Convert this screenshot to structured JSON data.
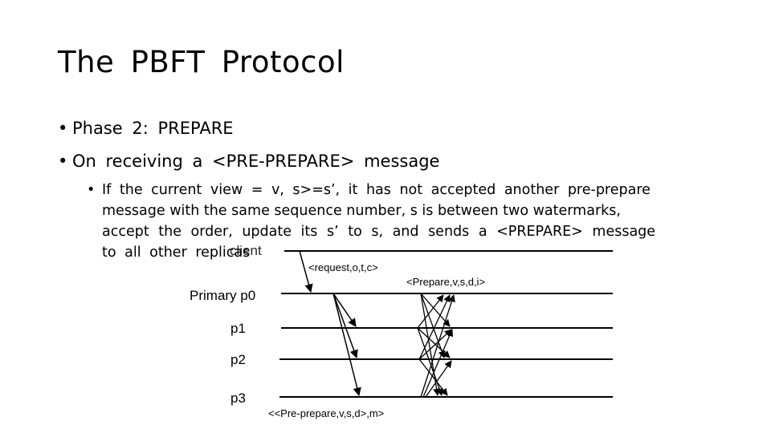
{
  "slide": {
    "title": "The  PBFT  Protocol",
    "bullets": [
      {
        "dot": "•",
        "text": "Phase  2:  PREPARE"
      },
      {
        "dot": "•",
        "text": "On  receiving  a  <PRE-PREPARE>  message"
      }
    ],
    "sub_bullet": {
      "dot": "•",
      "lines": [
        "If  the  current  view  =  v,  s>=s’,  it has not accepted another pre-prepare",
        "message with the same sequence number, s is between two watermarks,",
        "accept  the  order,  update  its  s’  to  s,  and  sends  a  <PREPARE>  message",
        "to  all  other  replicas"
      ]
    }
  },
  "diagram": {
    "overlay_label": "client",
    "node_labels": [
      "Primary p0",
      "p1",
      "p2",
      "p3"
    ],
    "messages": {
      "request": "<request,o,t,c>",
      "prepare": "<Prepare,v,s,d,i>",
      "pre_prepare": "<<Pre-prepare,v,s,d>,m>"
    }
  }
}
